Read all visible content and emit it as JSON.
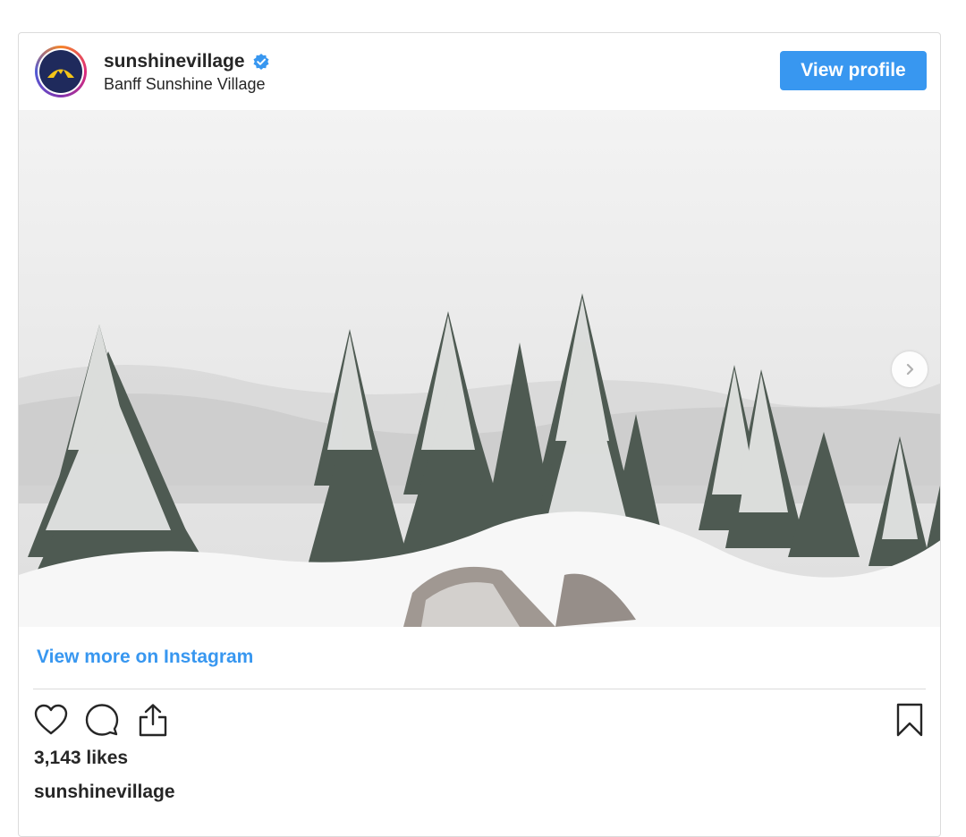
{
  "post": {
    "username": "sunshinevillage",
    "full_name": "Banff Sunshine Village",
    "view_profile_label": "View profile",
    "view_more_label": "View more on Instagram",
    "likes_text": "3,143 likes",
    "caption_username": "sunshinevillage"
  },
  "icons": {
    "verified": "verified-badge-icon",
    "next": "chevron-right-icon",
    "like": "heart-icon",
    "comment": "comment-icon",
    "share": "share-icon",
    "save": "bookmark-icon"
  },
  "colors": {
    "accent": "#3897f0",
    "text": "#262626",
    "border": "#dbdbdb",
    "avatar_bg": "#1f2a5c",
    "logo_yellow": "#f5c518"
  }
}
